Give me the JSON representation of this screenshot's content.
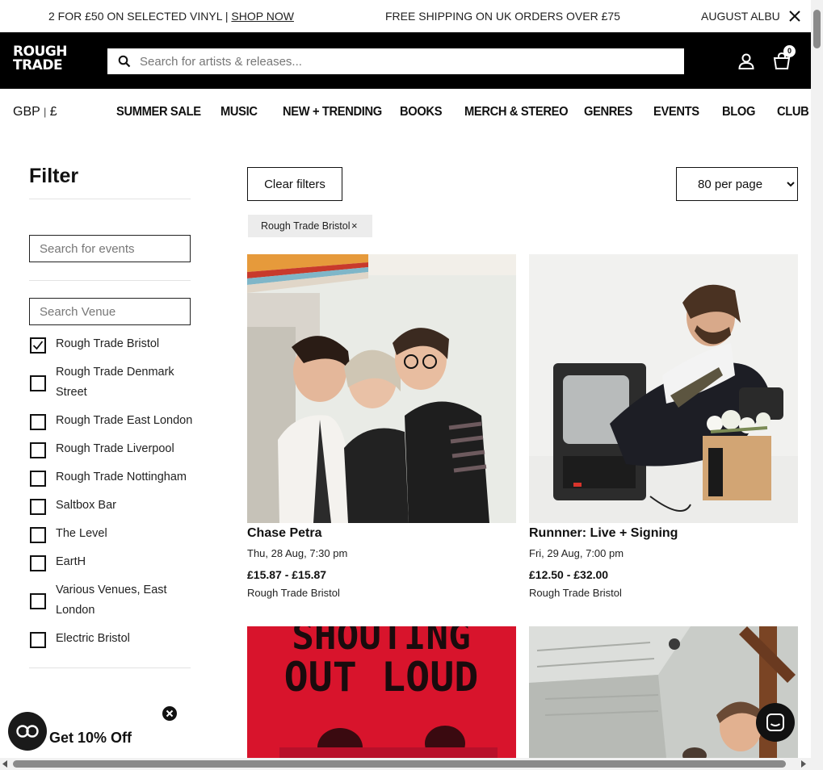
{
  "announcement": {
    "promo_text": "2 FOR £50 ON SELECTED VINYL  |  ",
    "promo_link": "SHOP NOW",
    "shipping_text": "FREE SHIPPING ON UK ORDERS OVER £75",
    "album_text": "AUGUST ALBUMS"
  },
  "header": {
    "logo_line1": "ROUGH",
    "logo_line2": "TRADE",
    "search_placeholder": "Search for artists & releases...",
    "cart_count": "0"
  },
  "nav": {
    "currency": "GBP",
    "currency_sep": "|",
    "currency_symbol": "£",
    "items": [
      "SUMMER SALE",
      "MUSIC",
      "NEW + TRENDING",
      "BOOKS",
      "MERCH & STEREO",
      "GENRES",
      "EVENTS",
      "BLOG",
      "CLUB"
    ]
  },
  "sidebar": {
    "title": "Filter",
    "event_search_placeholder": "Search for events",
    "venue_search_placeholder": "Search Venue",
    "venues": [
      {
        "label": "Rough Trade Bristol",
        "checked": true
      },
      {
        "label": "Rough Trade Denmark Street",
        "checked": false
      },
      {
        "label": "Rough Trade East London",
        "checked": false
      },
      {
        "label": "Rough Trade Liverpool",
        "checked": false
      },
      {
        "label": "Rough Trade Nottingham",
        "checked": false
      },
      {
        "label": "Saltbox Bar",
        "checked": false
      },
      {
        "label": "The Level",
        "checked": false
      },
      {
        "label": "EartH",
        "checked": false
      },
      {
        "label": "Various Venues, East London",
        "checked": false
      },
      {
        "label": "Electric Bristol",
        "checked": false
      }
    ]
  },
  "toolbar": {
    "clear_label": "Clear filters",
    "per_page_selected": "80 per page",
    "active_filter": "Rough Trade Bristol",
    "remove_symbol": "×"
  },
  "events": [
    {
      "title": "Chase Petra",
      "date": "Thu, 28 Aug, 7:30 pm",
      "price": "£15.87 - £15.87",
      "venue": "Rough Trade Bristol"
    },
    {
      "title": "Runnner: Live + Signing",
      "date": "Fri, 29 Aug, 7:00 pm",
      "price": "£12.50 - £32.00",
      "venue": "Rough Trade Bristol"
    },
    {
      "image_text": "SHOUTING OUT LOUD"
    },
    {}
  ],
  "popup": {
    "promo_text": "Get 10% Off"
  }
}
